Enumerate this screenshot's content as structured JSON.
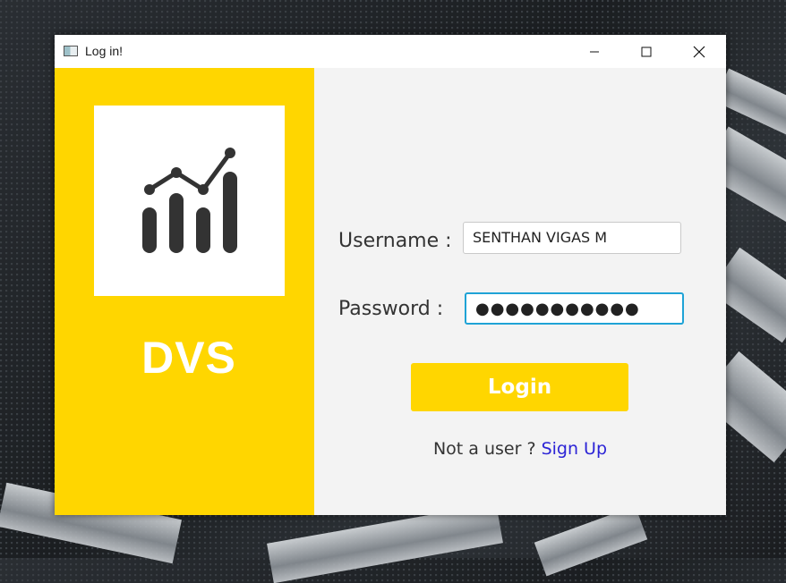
{
  "window": {
    "title": "Log in!"
  },
  "brand": {
    "name": "DVS",
    "logo_icon": "bar-chart-trend-icon",
    "panel_color": "#ffd600"
  },
  "form": {
    "username_label": "Username :",
    "username_value": "SENTHAN VIGAS M",
    "password_label": "Password  :",
    "password_masked": "●●●●●●●●●●●",
    "login_label": "Login",
    "signup_prompt": "Not a user ? ",
    "signup_link": "Sign Up",
    "focus_color": "#1fa3d6",
    "link_color": "#2c24d6"
  }
}
